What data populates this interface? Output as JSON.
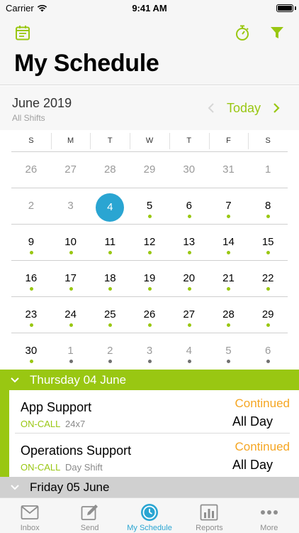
{
  "status_bar": {
    "carrier": "Carrier",
    "time": "9:41 AM"
  },
  "nav": {
    "title": "My Schedule",
    "left_icon": "calendar-icon",
    "right_icons": [
      "stopwatch-icon",
      "filter-icon"
    ]
  },
  "colors": {
    "accent_green": "#99c712",
    "selected_blue": "#2aa5d2",
    "continued_orange": "#f5a623",
    "grey_section": "#d0d0d0"
  },
  "calendar": {
    "month": "June 2019",
    "filter_label": "All Shifts",
    "today_label": "Today",
    "weekdays": [
      "S",
      "M",
      "T",
      "W",
      "T",
      "F",
      "S"
    ],
    "weeks": [
      [
        {
          "d": "26",
          "other": true,
          "dot": ""
        },
        {
          "d": "27",
          "other": true,
          "dot": ""
        },
        {
          "d": "28",
          "other": true,
          "dot": ""
        },
        {
          "d": "29",
          "other": true,
          "dot": ""
        },
        {
          "d": "30",
          "other": true,
          "dot": ""
        },
        {
          "d": "31",
          "other": true,
          "dot": ""
        },
        {
          "d": "1",
          "other": true,
          "dot": ""
        }
      ],
      [
        {
          "d": "2",
          "other": true,
          "dot": ""
        },
        {
          "d": "3",
          "other": true,
          "dot": ""
        },
        {
          "d": "4",
          "other": false,
          "dot": "",
          "selected": true
        },
        {
          "d": "5",
          "other": false,
          "dot": "green"
        },
        {
          "d": "6",
          "other": false,
          "dot": "green"
        },
        {
          "d": "7",
          "other": false,
          "dot": "green"
        },
        {
          "d": "8",
          "other": false,
          "dot": "green"
        }
      ],
      [
        {
          "d": "9",
          "other": false,
          "dot": "green"
        },
        {
          "d": "10",
          "other": false,
          "dot": "green"
        },
        {
          "d": "11",
          "other": false,
          "dot": "green"
        },
        {
          "d": "12",
          "other": false,
          "dot": "green"
        },
        {
          "d": "13",
          "other": false,
          "dot": "green"
        },
        {
          "d": "14",
          "other": false,
          "dot": "green"
        },
        {
          "d": "15",
          "other": false,
          "dot": "green"
        }
      ],
      [
        {
          "d": "16",
          "other": false,
          "dot": "green"
        },
        {
          "d": "17",
          "other": false,
          "dot": "green"
        },
        {
          "d": "18",
          "other": false,
          "dot": "green"
        },
        {
          "d": "19",
          "other": false,
          "dot": "green"
        },
        {
          "d": "20",
          "other": false,
          "dot": "green"
        },
        {
          "d": "21",
          "other": false,
          "dot": "green"
        },
        {
          "d": "22",
          "other": false,
          "dot": "green"
        }
      ],
      [
        {
          "d": "23",
          "other": false,
          "dot": "green"
        },
        {
          "d": "24",
          "other": false,
          "dot": "green"
        },
        {
          "d": "25",
          "other": false,
          "dot": "green"
        },
        {
          "d": "26",
          "other": false,
          "dot": "green"
        },
        {
          "d": "27",
          "other": false,
          "dot": "green"
        },
        {
          "d": "28",
          "other": false,
          "dot": "green"
        },
        {
          "d": "29",
          "other": false,
          "dot": "green"
        }
      ],
      [
        {
          "d": "30",
          "other": false,
          "dot": "green"
        },
        {
          "d": "1",
          "other": true,
          "dot": "grey"
        },
        {
          "d": "2",
          "other": true,
          "dot": "grey"
        },
        {
          "d": "3",
          "other": true,
          "dot": "grey"
        },
        {
          "d": "4",
          "other": true,
          "dot": "grey"
        },
        {
          "d": "5",
          "other": true,
          "dot": "grey"
        },
        {
          "d": "6",
          "other": true,
          "dot": "grey"
        }
      ]
    ]
  },
  "sections": [
    {
      "label": "Thursday 04 June",
      "shifts": [
        {
          "name": "App Support",
          "tag": "ON-CALL",
          "detail": "24x7",
          "status": "Continued",
          "time": "All Day"
        },
        {
          "name": "Operations Support",
          "tag": "ON-CALL",
          "detail": "Day Shift",
          "status": "Continued",
          "time": "All Day"
        }
      ]
    },
    {
      "label": "Friday 05 June",
      "shifts": []
    }
  ],
  "tabbar": [
    {
      "label": "Inbox",
      "icon": "inbox-icon"
    },
    {
      "label": "Send",
      "icon": "compose-icon"
    },
    {
      "label": "My Schedule",
      "icon": "clock-icon",
      "active": true
    },
    {
      "label": "Reports",
      "icon": "bar-chart-icon"
    },
    {
      "label": "More",
      "icon": "more-icon"
    }
  ]
}
